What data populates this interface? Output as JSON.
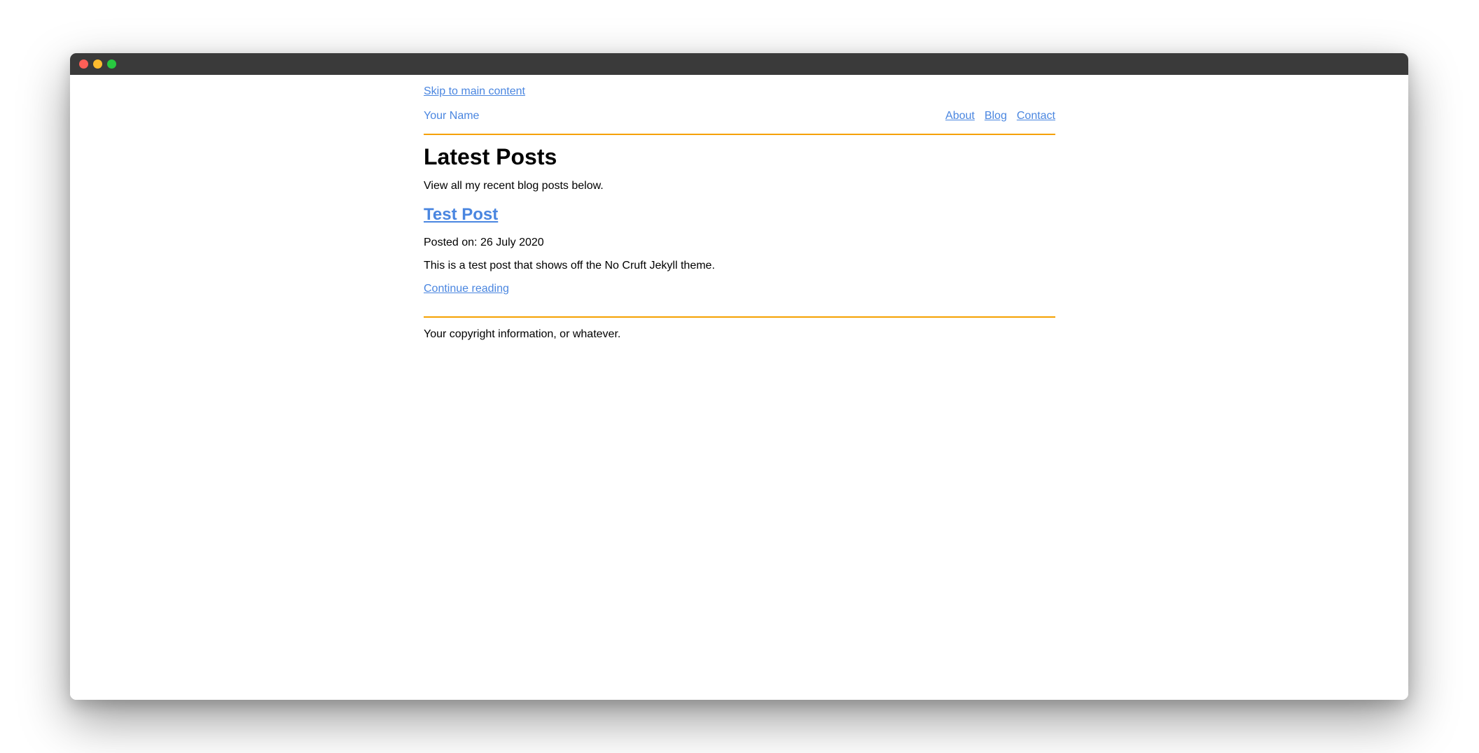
{
  "window": {
    "controls": [
      "close",
      "minimize",
      "zoom"
    ],
    "colors": {
      "titlebar": "#3a3a3a",
      "close": "#fe5f57",
      "minimize": "#febc2e",
      "zoom": "#28c840"
    }
  },
  "skip_link": "Skip to main content",
  "header": {
    "site_name": "Your Name",
    "nav": [
      {
        "label": "About"
      },
      {
        "label": "Blog"
      },
      {
        "label": "Contact"
      }
    ]
  },
  "main": {
    "title": "Latest Posts",
    "intro": "View all my recent blog posts below.",
    "posts": [
      {
        "title": "Test Post",
        "date": "Posted on: 26 July 2020",
        "excerpt": "This is a test post that shows off the No Cruft Jekyll theme.",
        "continue_label": "Continue reading"
      }
    ]
  },
  "footer": {
    "text": "Your copyright information, or whatever."
  },
  "colors": {
    "link": "#4a86e0",
    "accent_rule": "#f5a100",
    "text": "#000000"
  }
}
